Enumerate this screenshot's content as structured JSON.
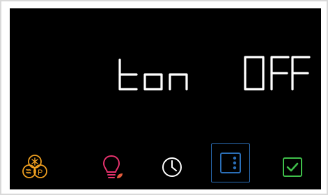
{
  "display": {
    "parameter": "ton",
    "value": "OFF",
    "segment_color": "#ffffff"
  },
  "bottom_bar": {
    "items": [
      {
        "name": "defrost-p-icon",
        "color": "#f0a020"
      },
      {
        "name": "eco-bulb-icon",
        "color": "#e8326e",
        "accent": "#e25a3c"
      },
      {
        "name": "clock-icon",
        "color": "#ffffff"
      },
      {
        "name": "menu-icon",
        "color": "#2b6fb8",
        "selected": true
      },
      {
        "name": "confirm-check-icon",
        "color": "#3fbf4a"
      }
    ]
  }
}
